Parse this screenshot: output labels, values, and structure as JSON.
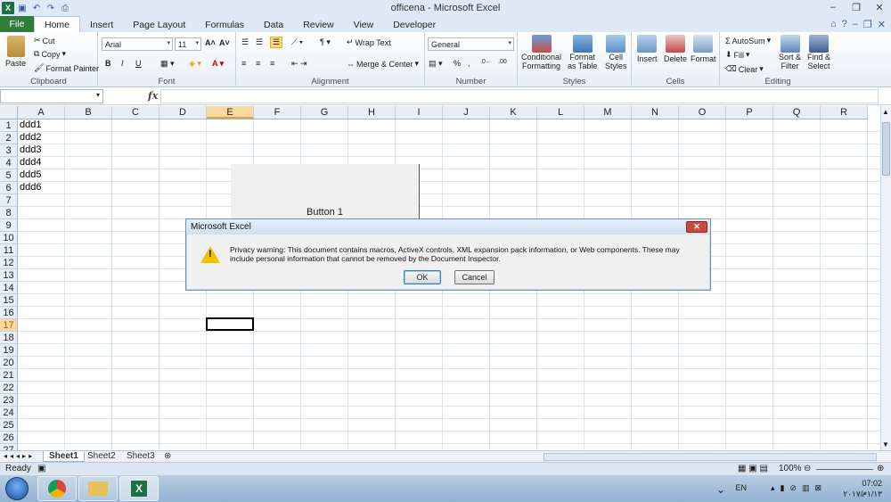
{
  "window": {
    "title": "officena - Microsoft Excel"
  },
  "qat_icons": [
    "excel-logo",
    "save-icon",
    "undo-icon",
    "redo-icon",
    "print-preview-icon"
  ],
  "tabs": [
    "File",
    "Home",
    "Insert",
    "Page Layout",
    "Formulas",
    "Data",
    "Review",
    "View",
    "Developer"
  ],
  "active_tab": "Home",
  "ribbon": {
    "clipboard": {
      "paste": "Paste",
      "cut": "Cut",
      "copy": "Copy",
      "format_painter": "Format Painter",
      "label": "Clipboard"
    },
    "font": {
      "name": "Arial",
      "size": "11",
      "label": "Font",
      "bold": "B",
      "italic": "I",
      "underline": "U"
    },
    "alignment": {
      "wrap": "Wrap Text",
      "merge": "Merge & Center",
      "label": "Alignment"
    },
    "number": {
      "format": "General",
      "label": "Number"
    },
    "styles": {
      "cond1": "Conditional",
      "cond2": "Formatting",
      "fmt1": "Format",
      "fmt2": "as Table",
      "cell1": "Cell",
      "cell2": "Styles",
      "label": "Styles"
    },
    "cells": {
      "insert": "Insert",
      "delete": "Delete",
      "format": "Format",
      "label": "Cells"
    },
    "editing": {
      "autosum": "AutoSum",
      "fill": "Fill",
      "clear": "Clear",
      "sort1": "Sort &",
      "sort2": "Filter",
      "find1": "Find &",
      "find2": "Select",
      "label": "Editing"
    }
  },
  "formula_bar": {
    "fx": "fx",
    "name_box": "",
    "content": ""
  },
  "columns": [
    "A",
    "B",
    "C",
    "D",
    "E",
    "F",
    "G",
    "H",
    "I",
    "J",
    "K",
    "L",
    "M",
    "N",
    "O",
    "P",
    "Q",
    "R"
  ],
  "selected_column": "E",
  "rows": [
    "1",
    "2",
    "3",
    "4",
    "5",
    "6",
    "7",
    "8",
    "9",
    "10",
    "11",
    "12",
    "13",
    "14",
    "15",
    "16",
    "17",
    "18",
    "19",
    "20",
    "21",
    "22",
    "23",
    "24",
    "25",
    "26",
    "27"
  ],
  "selected_row": "17",
  "cells": [
    "ddd1",
    "ddd2",
    "ddd3",
    "ddd4",
    "ddd5",
    "ddd6"
  ],
  "activex_button": {
    "label": "Button 1"
  },
  "dialog": {
    "title": "Microsoft Excel",
    "message": "Privacy warning: This document contains macros, ActiveX controls, XML expansion pack information, or Web components. These may include personal information that cannot be removed by the Document Inspector.",
    "ok": "OK",
    "cancel": "Cancel"
  },
  "sheets": [
    "Sheet1",
    "Sheet2",
    "Sheet3"
  ],
  "active_sheet": "Sheet1",
  "status": {
    "ready": "Ready",
    "zoom": "100%"
  },
  "taskbar": {
    "lang": "EN",
    "time": "07:02 م",
    "date": "۲۰۱۷/۰۱/۱۳"
  }
}
